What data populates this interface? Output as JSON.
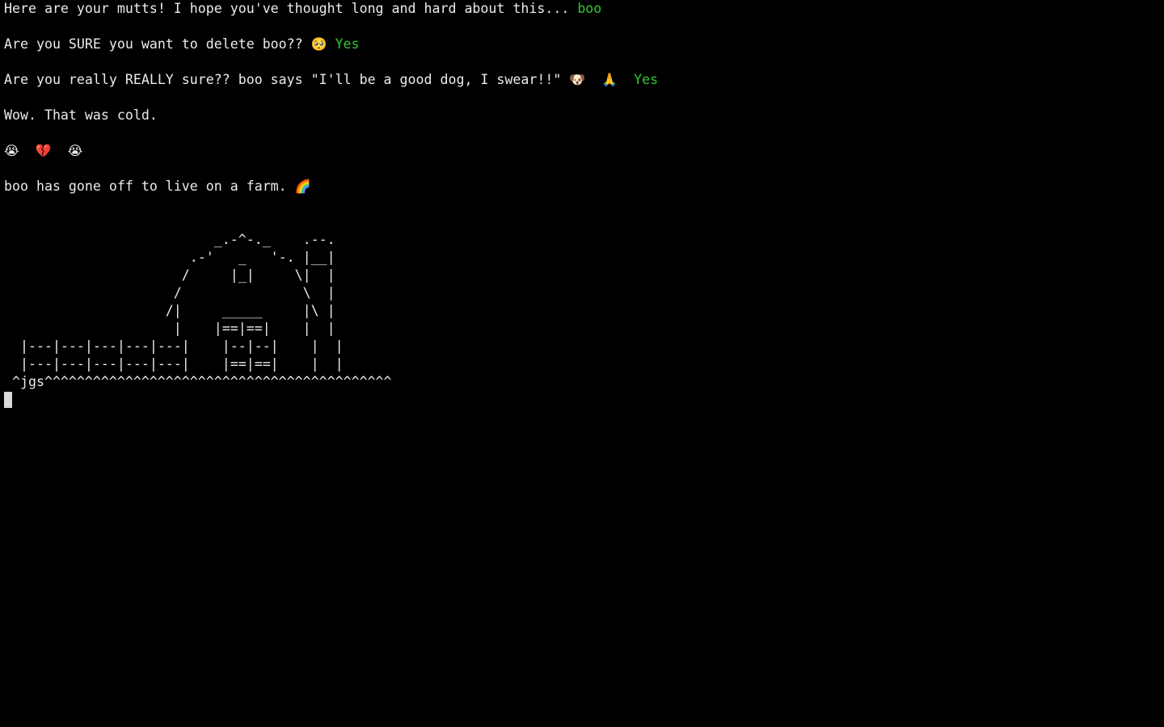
{
  "terminal": {
    "lines": {
      "prompt1": {
        "text": "Here are your mutts! I hope you've thought long and hard about this... ",
        "answer": "boo"
      },
      "prompt2": {
        "text": "Are you SURE you want to delete boo?? ",
        "emoji": "🥺",
        "answer": "Yes"
      },
      "prompt3": {
        "text": "Are you really REALLY sure?? boo says \"I'll be a good dog, I swear!!\" ",
        "emoji_dog": "🐶",
        "emoji_pray": "🙏",
        "answer": "Yes"
      },
      "reaction": {
        "text": "Wow. That was cold."
      },
      "emojis": {
        "sob_left": "😭",
        "broken_heart": "💔",
        "sob_right": "😭"
      },
      "farewell": {
        "text": "boo has gone off to live on a farm. ",
        "emoji": "🌈"
      }
    },
    "ascii_art": "                          _.-^-._    .--.\n                       .-'   _   '-. |__|\n                      /     |_|     \\|  |\n                     /               \\  |\n                    /|     _____     |\\ |\n                     |    |==|==|    |  |\n  |---|---|---|---|---|    |--|--|    |  |\n  |---|---|---|---|---|    |==|==|    |  |\n ^jgs^^^^^^^^^^^^^^^^^^^^^^^^^^^^^^^^^^^^^^^^^^^",
    "colors": {
      "background": "#000000",
      "text": "#ebebeb",
      "answer": "#2ec92e",
      "cursor": "#d9d9d9"
    }
  }
}
